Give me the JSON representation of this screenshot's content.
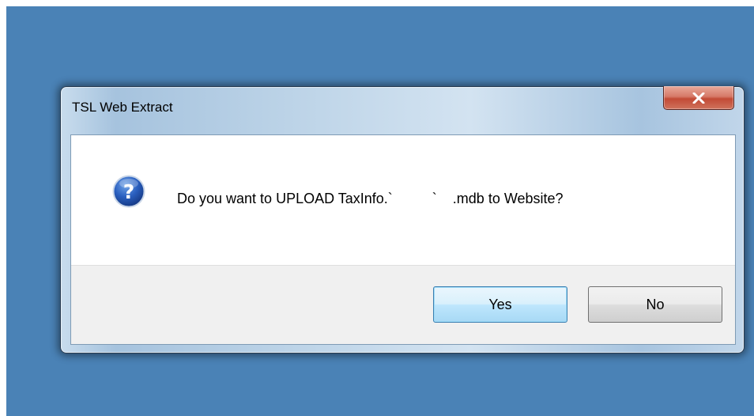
{
  "dialog": {
    "title": "TSL Web Extract",
    "close_icon": "close-icon",
    "message": "Do you want to UPLOAD TaxInfo.`          `    .mdb to Website?",
    "message_icon": "question-icon",
    "buttons": {
      "yes_label": "Yes",
      "no_label": "No"
    }
  },
  "colors": {
    "desktop": "#4a82b6",
    "close_button": "#c24a35",
    "button_area": "#f0f0f0",
    "default_button_border": "#3c7fb1"
  }
}
